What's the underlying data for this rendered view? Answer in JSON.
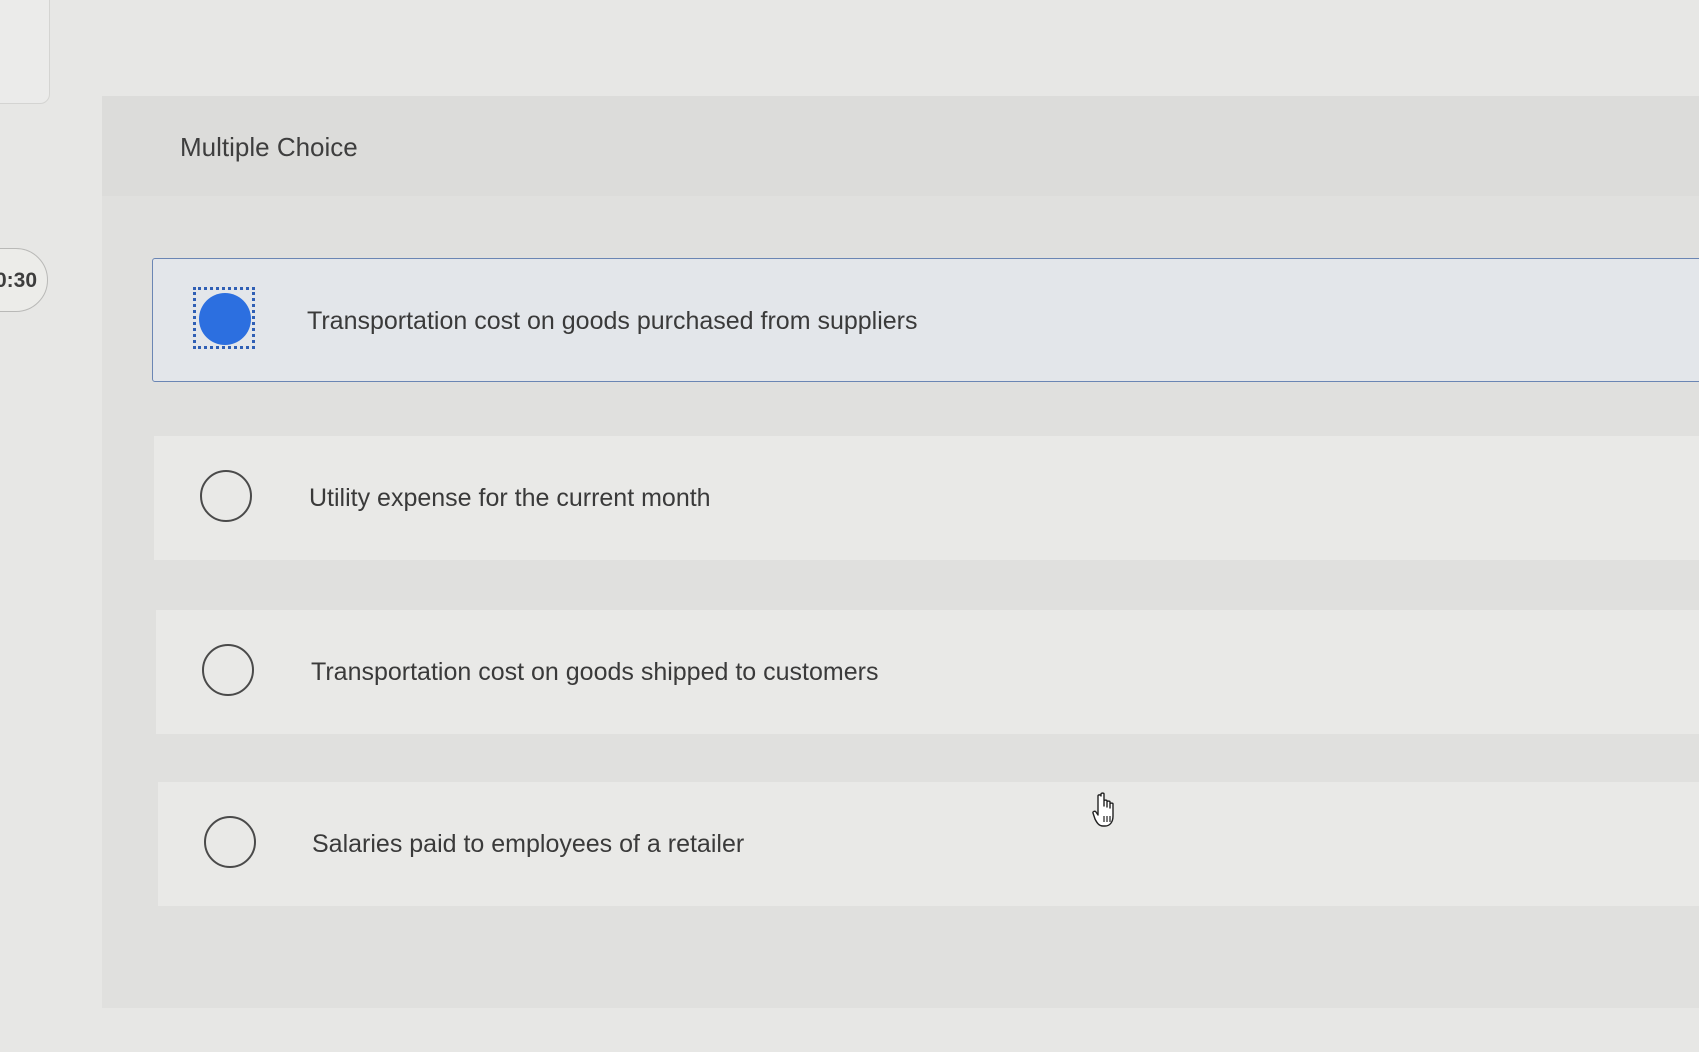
{
  "timer": {
    "text": "0:30"
  },
  "question": {
    "type_label": "Multiple Choice"
  },
  "options": [
    {
      "label": "Transportation cost on goods purchased from suppliers",
      "selected": true
    },
    {
      "label": "Utility expense for the current month",
      "selected": false
    },
    {
      "label": "Transportation cost on goods shipped to customers",
      "selected": false
    },
    {
      "label": "Salaries paid to employees of a retailer",
      "selected": false
    }
  ],
  "colors": {
    "accent": "#2c6fe0",
    "selected_border": "#6b86b4",
    "selected_bg": "#e3e6ea"
  },
  "icons": {
    "cursor": "hand-pointer-icon"
  }
}
